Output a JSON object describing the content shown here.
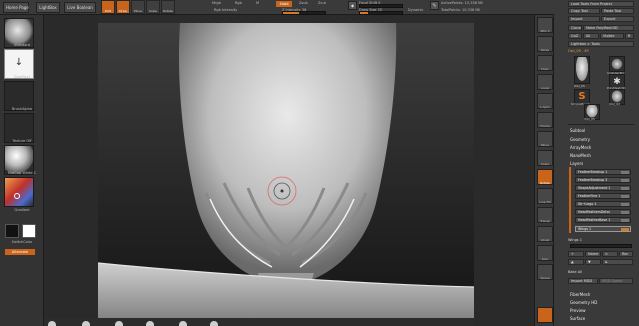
{
  "topbar": {
    "home": "Home Page",
    "lightbox": "LightBox",
    "live_boolean": "Live Boolean",
    "tools": [
      {
        "label": "Edit",
        "on": true
      },
      {
        "label": "Draw",
        "on": true
      },
      {
        "label": "Move",
        "on": false
      },
      {
        "label": "Scale",
        "on": false
      },
      {
        "label": "Rotate",
        "on": false
      }
    ],
    "mrgb": "Mrgb",
    "rgb": "Rgb",
    "m": "M",
    "zadd": "Zadd",
    "zsub": "Zsub",
    "zcut": "Zcut",
    "rgb_intensity": "Rgb Intensity",
    "z_intensity_label": "Z Intensity",
    "z_intensity_value": "38",
    "z_intensity_fraction": 0.38,
    "focal_label": "Focal Shift",
    "focal_value": "0",
    "focal_fraction": 0.0,
    "draw_size_label": "Draw Size",
    "draw_size_value": "25",
    "draw_size_fraction": 0.2,
    "dynamic": "Dynamic",
    "active_points": "ActivePoints: 10,338 Mil",
    "total_points": "TotalPoints: 10,338 Mil"
  },
  "left": {
    "brush": "Standard",
    "stroke": "DragRect",
    "alpha": "BrushAlpha",
    "texture": "Texture Off",
    "material": "MatCap White C",
    "gradient": "Gradient",
    "switch_color": "SwitchColor",
    "alternate": "Alternate"
  },
  "rstrip": [
    "SPix 3",
    "Persp",
    "Floor",
    "Local",
    "L.Sym",
    "Frame",
    "Move",
    "Scale",
    "Rotate",
    "Line Fill PolyF",
    "Transp",
    "Ghost",
    "Solo",
    "Xpose"
  ],
  "panel": {
    "load_tools": "Load Tools From Project",
    "copy_tool": "Copy Tool",
    "paste_tool": "Paste Tool",
    "import": "Import",
    "export": "Export",
    "clone": "Clone",
    "make_polymesh": "Make PolyMesh3D",
    "goz": "GoZ",
    "all": "All",
    "visible": "Visible",
    "r": "R",
    "lightbox_tools": "Lightbox > Tools",
    "current_tool": "Owl_05 . 49",
    "tool_count": "49",
    "tiles": [
      "Owl_05",
      "Cylinder3D",
      "PolyMesh3D",
      "SimpleBrush",
      "Owl_04",
      "Owl_05"
    ],
    "menus": [
      "Subtool",
      "Geometry",
      "ArrayMesh",
      "NanoMesh",
      "Layers"
    ],
    "layers": [
      "FeatherBreakup 1",
      "FeatherBreakup 3",
      "ShapeAdjustment 1",
      "FeatherFine 1",
      "Str+Lego 1",
      "HeadFeathersDetai",
      "HeadFeatherBase 1",
      "Wings 1"
    ],
    "wings_label": "Wings 1",
    "name": "Name",
    "rec": "Rec",
    "bake_all": "Bake All",
    "import_mdd": "Import MDD",
    "mdd_speed": "MDD Speed",
    "bottom_menus": [
      "FiberMesh",
      "Geometry HD",
      "Preview",
      "Surface"
    ]
  }
}
